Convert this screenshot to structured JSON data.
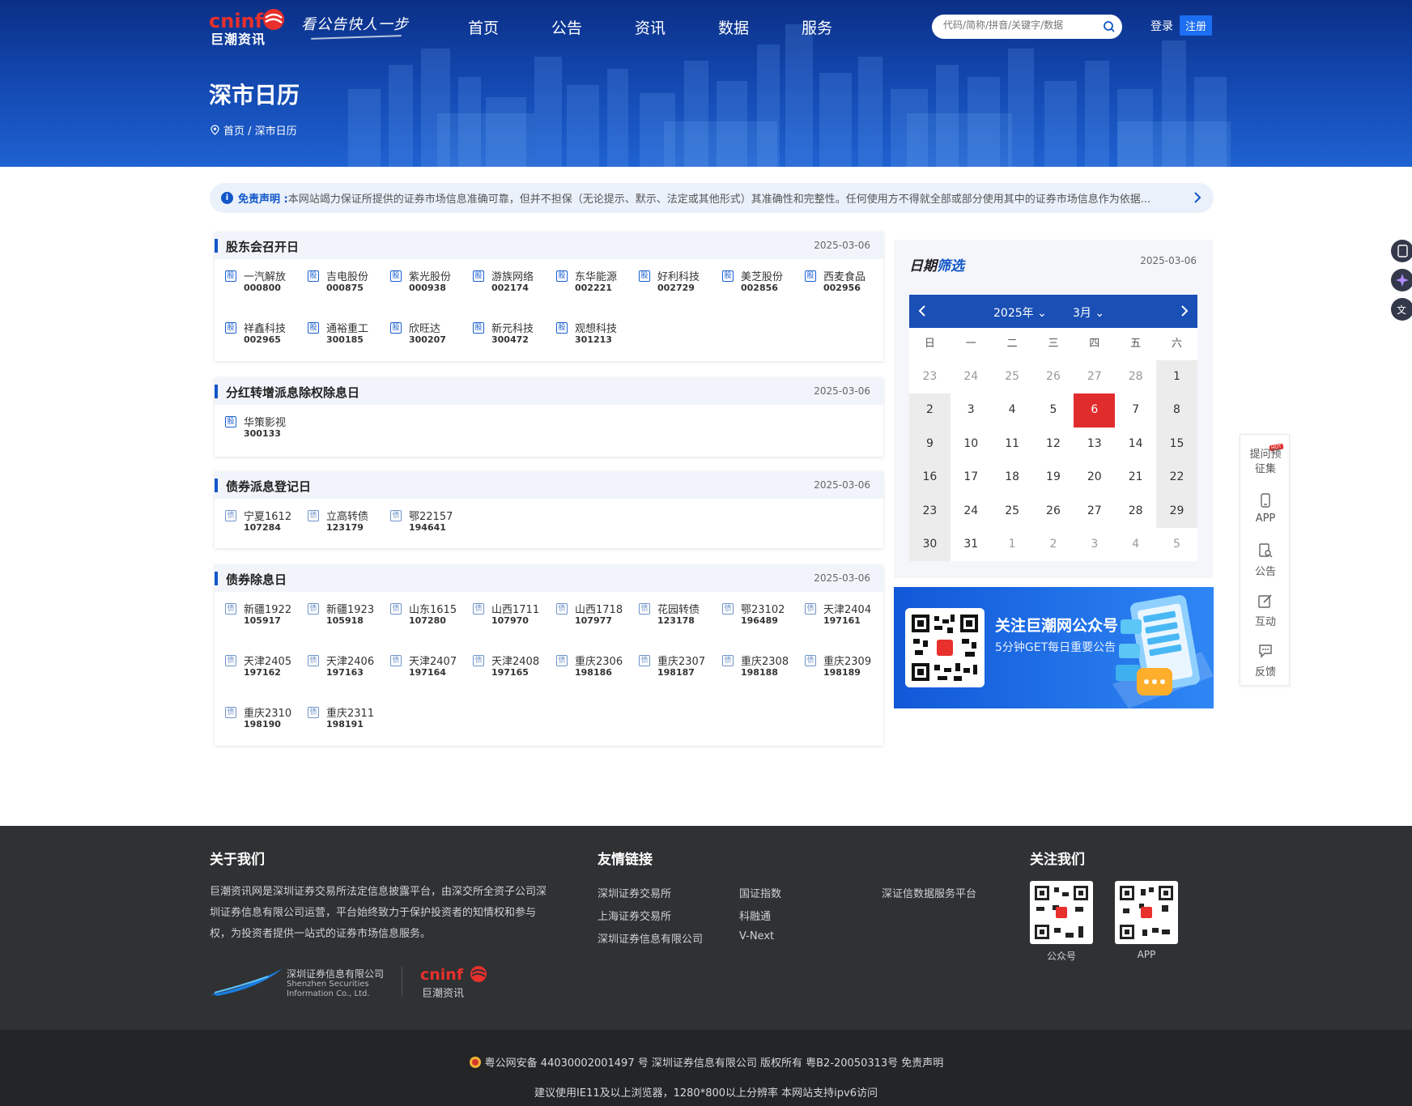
{
  "header": {
    "logo_cn": "巨潮资讯",
    "slogan": "看公告快人一步",
    "nav": [
      "首页",
      "公告",
      "资讯",
      "数据",
      "服务"
    ],
    "search_placeholder": "代码/简称/拼音/关键字/数据",
    "login": "登录",
    "register": "注册",
    "page_title": "深市日历",
    "breadcrumb": "首页 / 深市日历"
  },
  "disclaimer": {
    "title": "免责声明 :",
    "text": "本网站竭力保证所提供的证券市场信息准确可靠，但并不担保（无论提示、默示、法定或其他形式）其准确性和完整性。任何使用方不得就全部或部分使用其中的证券市场信息作为依据..."
  },
  "sections": [
    {
      "title": "股东会召开日",
      "date": "2025-03-06",
      "tag": "股",
      "items": [
        {
          "name": "一汽解放",
          "code": "000800"
        },
        {
          "name": "吉电股份",
          "code": "000875"
        },
        {
          "name": "紫光股份",
          "code": "000938"
        },
        {
          "name": "游族网络",
          "code": "002174"
        },
        {
          "name": "东华能源",
          "code": "002221"
        },
        {
          "name": "好利科技",
          "code": "002729"
        },
        {
          "name": "美芝股份",
          "code": "002856"
        },
        {
          "name": "西麦食品",
          "code": "002956"
        },
        {
          "name": "祥鑫科技",
          "code": "002965"
        },
        {
          "name": "通裕重工",
          "code": "300185"
        },
        {
          "name": "欣旺达",
          "code": "300207"
        },
        {
          "name": "新元科技",
          "code": "300472"
        },
        {
          "name": "观想科技",
          "code": "301213"
        }
      ]
    },
    {
      "title": "分红转增派息除权除息日",
      "date": "2025-03-06",
      "tag": "股",
      "items": [
        {
          "name": "华策影视",
          "code": "300133"
        }
      ]
    },
    {
      "title": "债券派息登记日",
      "date": "2025-03-06",
      "tag": "债",
      "items": [
        {
          "name": "宁夏1612",
          "code": "107284"
        },
        {
          "name": "立高转债",
          "code": "123179"
        },
        {
          "name": "鄂22157",
          "code": "194641"
        }
      ]
    },
    {
      "title": "债券除息日",
      "date": "2025-03-06",
      "tag": "债",
      "items": [
        {
          "name": "新疆1922",
          "code": "105917"
        },
        {
          "name": "新疆1923",
          "code": "105918"
        },
        {
          "name": "山东1615",
          "code": "107280"
        },
        {
          "name": "山西1711",
          "code": "107970"
        },
        {
          "name": "山西1718",
          "code": "107977"
        },
        {
          "name": "花园转债",
          "code": "123178"
        },
        {
          "name": "鄂23102",
          "code": "196489"
        },
        {
          "name": "天津2404",
          "code": "197161"
        },
        {
          "name": "天津2405",
          "code": "197162"
        },
        {
          "name": "天津2406",
          "code": "197163"
        },
        {
          "name": "天津2407",
          "code": "197164"
        },
        {
          "name": "天津2408",
          "code": "197165"
        },
        {
          "name": "重庆2306",
          "code": "198186"
        },
        {
          "name": "重庆2307",
          "code": "198187"
        },
        {
          "name": "重庆2308",
          "code": "198188"
        },
        {
          "name": "重庆2309",
          "code": "198189"
        },
        {
          "name": "重庆2310",
          "code": "198190"
        },
        {
          "name": "重庆2311",
          "code": "198191"
        }
      ]
    }
  ],
  "calendar": {
    "title_a": "日期",
    "title_b": "筛选",
    "date": "2025-03-06",
    "year": "2025年",
    "month": "3月",
    "weekdays": [
      "日",
      "一",
      "二",
      "三",
      "四",
      "五",
      "六"
    ],
    "days": [
      [
        "23",
        "24",
        "25",
        "26",
        "27",
        "28",
        "1"
      ],
      [
        "2",
        "3",
        "4",
        "5",
        "6",
        "7",
        "8"
      ],
      [
        "9",
        "10",
        "11",
        "12",
        "13",
        "14",
        "15"
      ],
      [
        "16",
        "17",
        "18",
        "19",
        "20",
        "21",
        "22"
      ],
      [
        "23",
        "24",
        "25",
        "26",
        "27",
        "28",
        "29"
      ],
      [
        "30",
        "31",
        "1",
        "2",
        "3",
        "4",
        "5"
      ]
    ],
    "selected": "6"
  },
  "follow": {
    "title": "关注巨潮网公众号",
    "subtitle": "5分钟GET每日重要公告"
  },
  "sidetool": {
    "items": [
      "提问预征集",
      "APP",
      "公告",
      "互动",
      "反馈"
    ],
    "hot": "HOT"
  },
  "footer": {
    "about_title": "关于我们",
    "about_text": "巨潮资讯网是深圳证券交易所法定信息披露平台，由深交所全资子公司深圳证券信息有限公司运营，平台始终致力于保护投资者的知情权和参与权，为投资者提供一站式的证券市场信息服务。",
    "sz_info_cn": "深圳证券信息有限公司",
    "sz_info_en1": "Shenzhen Securities",
    "sz_info_en2": "Information Co., Ltd.",
    "links_title": "友情链接",
    "links": [
      "深圳证券交易所",
      "上海证券交易所",
      "深圳证券信息有限公司",
      "国证指数",
      "科融通",
      "V-Next",
      "深证信数据服务平台"
    ],
    "follow_title": "关注我们",
    "qr1": "公众号",
    "qr2": "APP",
    "bottom1": "粤公网安备 44030002001497 号    深圳证券信息有限公司 版权所有 粤B2-20050313号    免责声明",
    "bottom2": "建议使用IE11及以上浏览器，1280*800以上分辨率 本网站支持ipv6访问"
  },
  "colors": {
    "primary": "#1156c8",
    "today": "#e02c2c",
    "footer": "#2f3133"
  }
}
